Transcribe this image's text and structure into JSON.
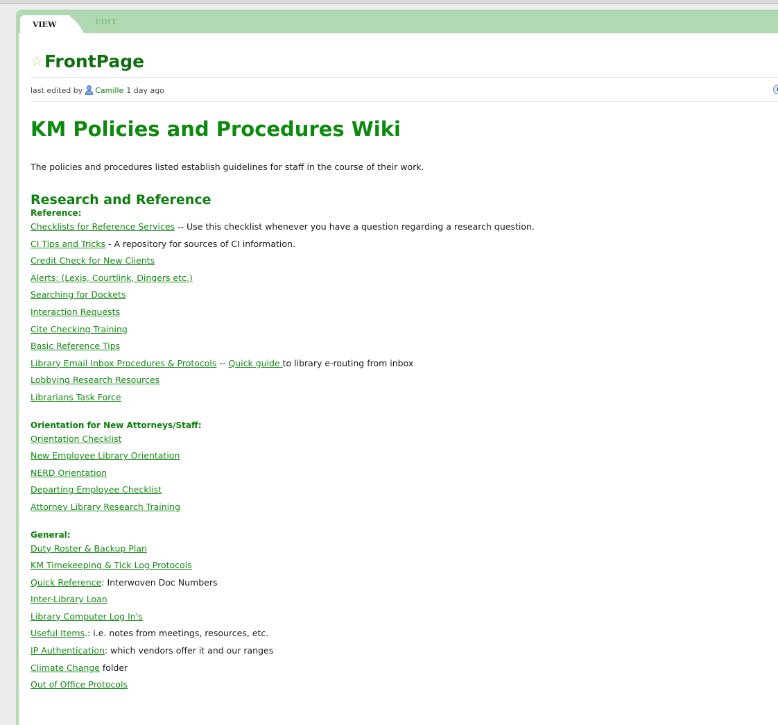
{
  "tabs": {
    "view": "VIEW",
    "edit": "EDIT"
  },
  "page": {
    "title": "FrontPage"
  },
  "meta": {
    "prefix": "last edited by",
    "author": "Camille",
    "when": "1 day ago"
  },
  "heading": "KM Policies and Procedures Wiki",
  "intro": "The policies and procedures listed establish guidelines for staff in the course of their work.",
  "section": {
    "title": "Research and Reference",
    "reference": {
      "label": "Reference:",
      "items": [
        {
          "link": "Checklists for Reference Services",
          "text": " -- Use this checklist whenever you have a question regarding a research question."
        },
        {
          "link": "CI Tips and Tricks",
          "text": " - A repository for sources of CI information."
        },
        {
          "link": "Credit Check for New Clients",
          "text": ""
        },
        {
          "link": "Alerts: (Lexis, Courtlink, Dingers etc.)",
          "text": ""
        },
        {
          "link": "Searching for Dockets",
          "text": ""
        },
        {
          "link": "Interaction Requests",
          "text": ""
        },
        {
          "link": "Cite Checking Training",
          "text": ""
        },
        {
          "link": "Basic Reference Tips",
          "text": ""
        },
        {
          "link": "Library Email Inbox Procedures & Protocols",
          "text": " -- ",
          "link2": "Quick guide ",
          "text2": "to library e-routing from inbox"
        },
        {
          "link": "Lobbying Research Resources",
          "text": ""
        },
        {
          "link": "Librarians Task Force",
          "text": ""
        }
      ]
    },
    "orientation": {
      "label": "Orientation for New Attorneys/Staff:",
      "items": [
        {
          "link": "Orientation Checklist",
          "text": ""
        },
        {
          "link": "New Employee Library Orientation",
          "text": ""
        },
        {
          "link": "NERD Orientation",
          "text": ""
        },
        {
          "link": "Departing Employee Checklist",
          "text": ""
        },
        {
          "link": "Attorney Library Research Training",
          "text": ""
        }
      ]
    },
    "general": {
      "label": "General:",
      "items": [
        {
          "link": "Duty Roster & Backup Plan",
          "text": ""
        },
        {
          "link": "KM Timekeeping & Tick Log Protocols",
          "text": ""
        },
        {
          "link": "Quick Reference",
          "text": ": Interwoven Doc Numbers"
        },
        {
          "link": "Inter-Library Loan",
          "text": ""
        },
        {
          "link": "Library Computer Log In's",
          "text": ""
        },
        {
          "link": "Useful Items",
          "text": ".: i.e. notes from meetings, resources, etc."
        },
        {
          "link": "IP Authentication",
          "text": ": which vendors offer it and our ranges"
        },
        {
          "link": "Climate Change",
          "text": " folder"
        },
        {
          "link": "Out of Office Protocols",
          "text": ""
        }
      ]
    }
  }
}
